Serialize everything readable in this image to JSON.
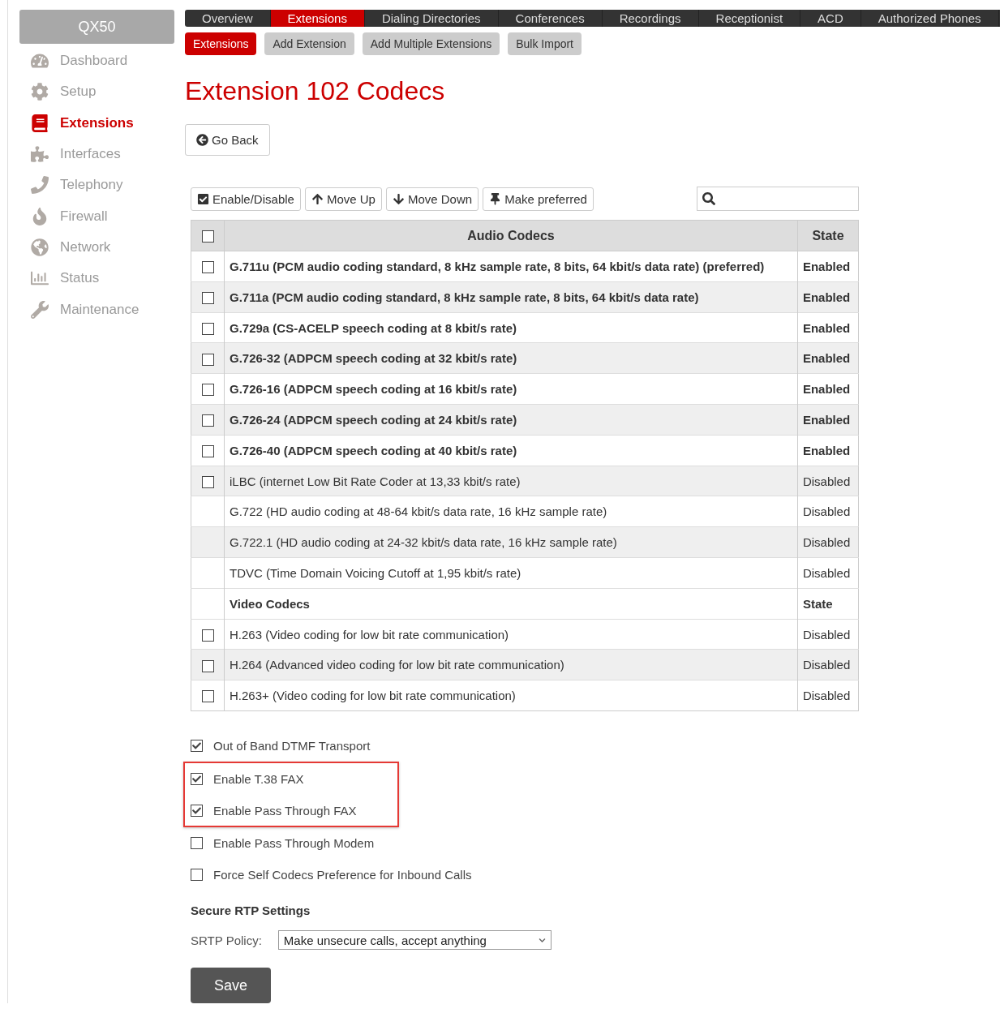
{
  "sidebar": {
    "brand": "QX50",
    "items": [
      {
        "label": "Dashboard",
        "selected": false
      },
      {
        "label": "Setup",
        "selected": false
      },
      {
        "label": "Extensions",
        "selected": true
      },
      {
        "label": "Interfaces",
        "selected": false
      },
      {
        "label": "Telephony",
        "selected": false
      },
      {
        "label": "Firewall",
        "selected": false
      },
      {
        "label": "Network",
        "selected": false
      },
      {
        "label": "Status",
        "selected": false
      },
      {
        "label": "Maintenance",
        "selected": false
      }
    ]
  },
  "nav_tabs": [
    {
      "label": "Overview",
      "selected": false
    },
    {
      "label": "Extensions",
      "selected": true
    },
    {
      "label": "Dialing Directories",
      "selected": false
    },
    {
      "label": "Conferences",
      "selected": false
    },
    {
      "label": "Recordings",
      "selected": false
    },
    {
      "label": "Receptionist",
      "selected": false
    },
    {
      "label": "ACD",
      "selected": false
    },
    {
      "label": "Authorized Phones",
      "selected": false
    }
  ],
  "sub_tabs": [
    {
      "label": "Extensions",
      "selected": true
    },
    {
      "label": "Add Extension",
      "selected": false
    },
    {
      "label": "Add Multiple Extensions",
      "selected": false
    },
    {
      "label": "Bulk Import",
      "selected": false
    }
  ],
  "title": "Extension 102 Codecs",
  "back_button": "Go Back",
  "toolbar": [
    "Enable/Disable",
    "Move Up",
    "Move Down",
    "Make preferred"
  ],
  "table": {
    "columns": [
      "Audio Codecs",
      "State"
    ],
    "header_checked": false,
    "rows": [
      {
        "kind": "codec",
        "name": "G.711u (PCM audio coding standard, 8 kHz sample rate, 8 bits, 64 kbit/s data rate) (preferred)",
        "state": "Enabled",
        "enabled": true,
        "selectable": true,
        "checked": false
      },
      {
        "kind": "codec",
        "name": "G.711a (PCM audio coding standard, 8 kHz sample rate, 8 bits, 64 kbit/s data rate)",
        "state": "Enabled",
        "enabled": true,
        "selectable": true,
        "checked": false
      },
      {
        "kind": "codec",
        "name": "G.729a (CS-ACELP speech coding at 8 kbit/s rate)",
        "state": "Enabled",
        "enabled": true,
        "selectable": true,
        "checked": false
      },
      {
        "kind": "codec",
        "name": "G.726-32 (ADPCM speech coding at 32 kbit/s rate)",
        "state": "Enabled",
        "enabled": true,
        "selectable": true,
        "checked": false
      },
      {
        "kind": "codec",
        "name": "G.726-16 (ADPCM speech coding at 16 kbit/s rate)",
        "state": "Enabled",
        "enabled": true,
        "selectable": true,
        "checked": false
      },
      {
        "kind": "codec",
        "name": "G.726-24 (ADPCM speech coding at 24 kbit/s rate)",
        "state": "Enabled",
        "enabled": true,
        "selectable": true,
        "checked": false
      },
      {
        "kind": "codec",
        "name": "G.726-40 (ADPCM speech coding at 40 kbit/s rate)",
        "state": "Enabled",
        "enabled": true,
        "selectable": true,
        "checked": false
      },
      {
        "kind": "codec",
        "name": "iLBC (internet Low Bit Rate Coder at 13,33 kbit/s rate)",
        "state": "Disabled",
        "enabled": false,
        "selectable": true,
        "checked": false
      },
      {
        "kind": "codec",
        "name": "G.722 (HD audio coding at 48-64 kbit/s data rate, 16 kHz sample rate)",
        "state": "Disabled",
        "enabled": false,
        "selectable": false
      },
      {
        "kind": "codec",
        "name": "G.722.1 (HD audio coding at 24-32 kbit/s data rate, 16 kHz sample rate)",
        "state": "Disabled",
        "enabled": false,
        "selectable": false
      },
      {
        "kind": "codec",
        "name": "TDVC (Time Domain Voicing Cutoff at 1,95 kbit/s rate)",
        "state": "Disabled",
        "enabled": false,
        "selectable": false
      },
      {
        "kind": "section",
        "name": "Video Codecs",
        "state": "State"
      },
      {
        "kind": "codec",
        "name": "H.263 (Video coding for low bit rate communication)",
        "state": "Disabled",
        "enabled": false,
        "selectable": true,
        "checked": false
      },
      {
        "kind": "codec",
        "name": "H.264 (Advanced video coding for low bit rate communication)",
        "state": "Disabled",
        "enabled": false,
        "selectable": true,
        "checked": false
      },
      {
        "kind": "codec",
        "name": "H.263+ (Video coding for low bit rate communication)",
        "state": "Disabled",
        "enabled": false,
        "selectable": true,
        "checked": false
      }
    ]
  },
  "option_groups": [
    {
      "highlighted": false,
      "options": [
        {
          "label": "Out of Band DTMF Transport",
          "checked": true
        }
      ]
    },
    {
      "highlighted": true,
      "options": [
        {
          "label": "Enable T.38 FAX",
          "checked": true
        },
        {
          "label": "Enable Pass Through FAX",
          "checked": true
        }
      ]
    },
    {
      "highlighted": false,
      "options": [
        {
          "label": "Enable Pass Through Modem",
          "checked": false
        },
        {
          "label": "Force Self Codecs Preference for Inbound Calls",
          "checked": false
        }
      ]
    }
  ],
  "srtp": {
    "heading": "Secure RTP Settings",
    "label": "SRTP Policy:",
    "value": "Make unsecure calls, accept anything"
  },
  "save_button": "Save"
}
